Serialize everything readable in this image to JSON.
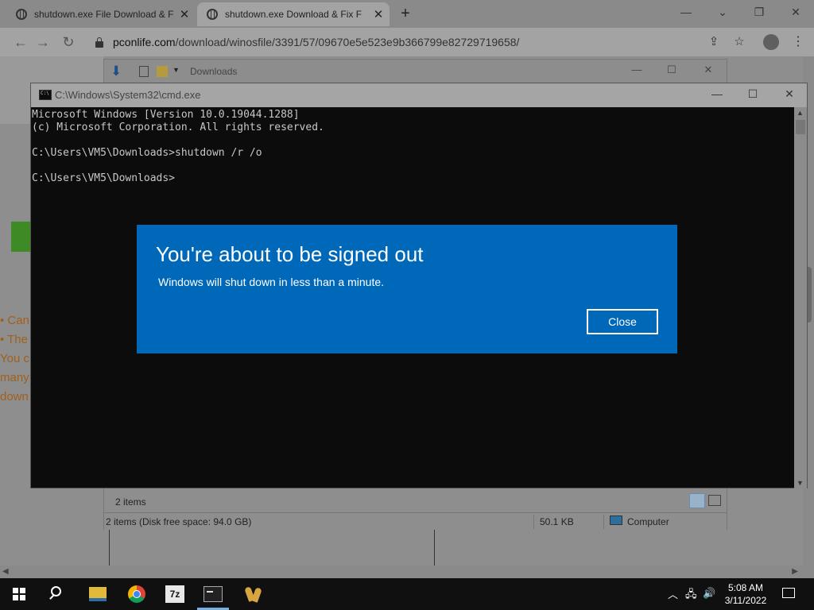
{
  "browser": {
    "tabs": [
      {
        "title": "shutdown.exe File Download & F",
        "close": "✕"
      },
      {
        "title": "shutdown.exe Download & Fix F",
        "close": "✕"
      }
    ],
    "new_tab": "+",
    "window_controls": {
      "minimize": "—",
      "restore": "❐",
      "close": "✕"
    },
    "nav": {
      "back": "←",
      "forward": "→",
      "reload": "↻"
    },
    "url_host": "pconlife.com",
    "url_path": "/download/winosfile/3391/57/09670e5e523e9b366799e82729719658/",
    "actions": {
      "share": "⇪",
      "bookmark": "☆",
      "menu": "⋮"
    }
  },
  "webpage": {
    "lines": [
      "• Can",
      "• The",
      "You c",
      "many",
      "down"
    ]
  },
  "explorer": {
    "title": "Downloads",
    "window_controls": {
      "minimize": "—",
      "maximize": "☐",
      "close": "✕"
    },
    "item_count": "2 items",
    "status_left": "2 items (Disk free space: 94.0 GB)",
    "status_size": "50.1 KB",
    "status_location": "Computer"
  },
  "cmd": {
    "title": "C:\\Windows\\System32\\cmd.exe",
    "window_controls": {
      "minimize": "—",
      "maximize": "☐",
      "close": "✕"
    },
    "output": "Microsoft Windows [Version 10.0.19044.1288]\n(c) Microsoft Corporation. All rights reserved.\n\nC:\\Users\\VM5\\Downloads>shutdown /r /o\n\nC:\\Users\\VM5\\Downloads>"
  },
  "dialog": {
    "heading": "You're about to be signed out",
    "message": "Windows will shut down in less than a minute.",
    "close_label": "Close"
  },
  "taskbar": {
    "apps": [
      "start",
      "search",
      "file-explorer",
      "chrome",
      "7-zip",
      "command-prompt",
      "keys-app"
    ],
    "sevenzip_label": "7z",
    "tray": {
      "chevron": "︿",
      "network": "🖧",
      "volume": "🔊"
    },
    "time": "5:08 AM",
    "date": "3/11/2022"
  }
}
